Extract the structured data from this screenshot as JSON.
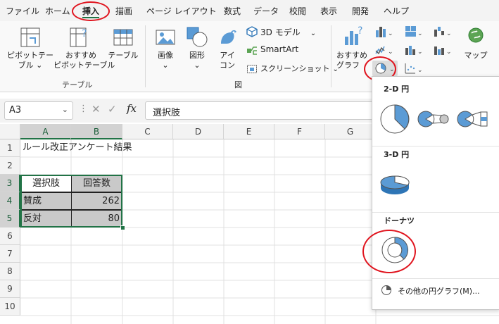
{
  "menu": {
    "tabs": [
      "ファイル",
      "ホーム",
      "挿入",
      "描画",
      "ページ レイアウト",
      "数式",
      "データ",
      "校閲",
      "表示",
      "開発",
      "ヘルプ"
    ],
    "active": "挿入"
  },
  "ribbon": {
    "table_group": {
      "pivot": "ピボットテー\nブル ⌄",
      "recommended_pivot": "おすすめ\nピボットテーブル",
      "table": "テーブル",
      "label": "テーブル"
    },
    "illust_group": {
      "image": "画像\n⌄",
      "shape": "図形\n⌄",
      "icon": "アイ\nコン",
      "model3d": "3D モデル",
      "smartart": "SmartArt",
      "screenshot": "スクリーンショット",
      "label": "図"
    },
    "charts": {
      "recommended": "おすすめ\nグラフ",
      "map": "マップ"
    }
  },
  "formula": {
    "namebox": "A3",
    "fx": "fx",
    "content": "選択肢"
  },
  "sheet": {
    "columns": [
      "A",
      "B",
      "C",
      "D",
      "E",
      "F",
      "G"
    ],
    "rows": [
      "1",
      "2",
      "3",
      "4",
      "5",
      "6",
      "7",
      "8",
      "9",
      "10"
    ],
    "title": "ルール改正アンケート結果",
    "header": [
      "選択肢",
      "回答数"
    ],
    "data": [
      {
        "label": "賛成",
        "value": "262"
      },
      {
        "label": "反対",
        "value": "80"
      }
    ]
  },
  "pie_menu": {
    "section_2d": "2-D 円",
    "section_3d": "3-D 円",
    "section_donut": "ドーナツ",
    "more": "その他の円グラフ(M)..."
  },
  "colors": {
    "accent": "#217346",
    "chart_blue": "#5b9bd5",
    "highlight": "#e0141e"
  }
}
